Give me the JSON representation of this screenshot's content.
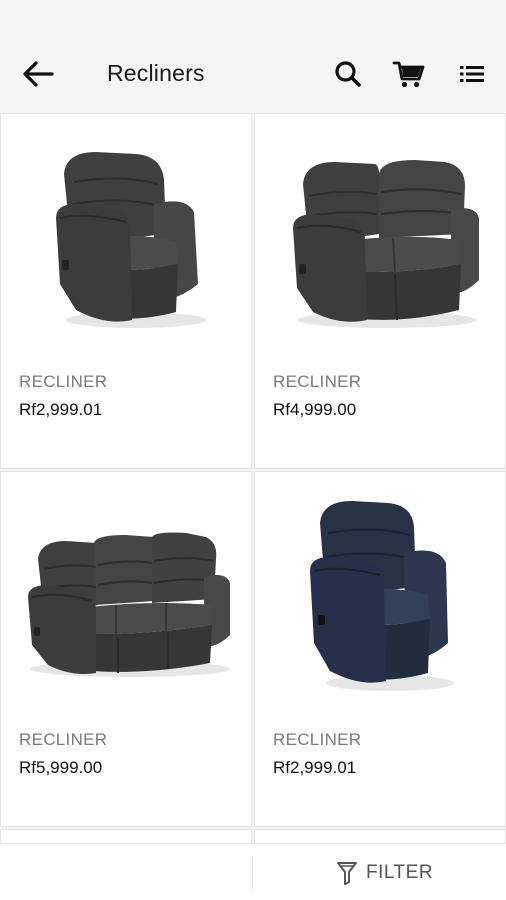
{
  "header": {
    "title": "Recliners"
  },
  "products": [
    {
      "name": "RECLINER",
      "price": "Rf2,999.01",
      "image": "single-recliner-grey"
    },
    {
      "name": "RECLINER",
      "price": "Rf4,999.00",
      "image": "two-seater-recliner-grey"
    },
    {
      "name": "RECLINER",
      "price": "Rf5,999.00",
      "image": "three-seater-recliner-grey"
    },
    {
      "name": "RECLINER",
      "price": "Rf2,999.01",
      "image": "single-recliner-navy"
    }
  ],
  "bottom_bar": {
    "filter_label": "FILTER"
  },
  "colors": {
    "background": "#f5f5f5",
    "card": "#ffffff",
    "sofa_grey": "#3e3f3f",
    "sofa_navy": "#283246"
  }
}
